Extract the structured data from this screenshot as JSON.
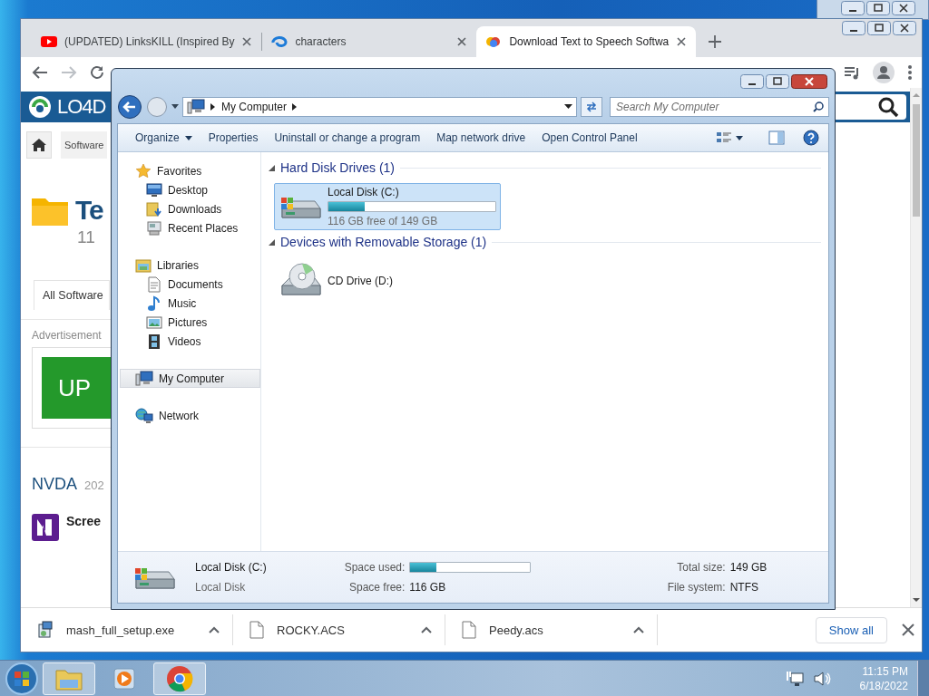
{
  "browser": {
    "tabs": [
      {
        "title": "(UPDATED) LinksKILL (Inspired By",
        "selected": false
      },
      {
        "title": "characters",
        "selected": false
      },
      {
        "title": "Download Text to Speech Softwa",
        "selected": true
      }
    ],
    "page": {
      "logo": "LO4D",
      "nav_tab": "Software",
      "title": "Te",
      "count": "11",
      "filter_tab": "All Software",
      "ad_label": "Advertisement",
      "ad_button": "UP",
      "app_name": "NVDA",
      "app_year": "202",
      "app_desc": "Scree"
    },
    "downloads": [
      {
        "name": "mash_full_setup.exe",
        "kind": "installer"
      },
      {
        "name": "ROCKY.ACS",
        "kind": "file"
      },
      {
        "name": "Peedy.acs",
        "kind": "file"
      }
    ],
    "show_all": "Show all"
  },
  "explorer": {
    "address": "My Computer",
    "search": {
      "placeholder": "Search My Computer"
    },
    "commands": [
      {
        "label": "Organize",
        "menu": true
      },
      {
        "label": "Properties",
        "menu": false
      },
      {
        "label": "Uninstall or change a program",
        "menu": false
      },
      {
        "label": "Map network drive",
        "menu": false
      },
      {
        "label": "Open Control Panel",
        "menu": false
      }
    ],
    "nav": [
      {
        "label": "Favorites",
        "kind": "star",
        "selected": false,
        "children": [
          {
            "label": "Desktop",
            "kind": "desktop",
            "selected": false
          },
          {
            "label": "Downloads",
            "kind": "downloads",
            "selected": false
          },
          {
            "label": "Recent Places",
            "kind": "recent",
            "selected": false
          }
        ]
      },
      {
        "label": "Libraries",
        "kind": "library",
        "selected": false,
        "children": [
          {
            "label": "Documents",
            "kind": "documents",
            "selected": false
          },
          {
            "label": "Music",
            "kind": "music",
            "selected": false
          },
          {
            "label": "Pictures",
            "kind": "pictures",
            "selected": false
          },
          {
            "label": "Videos",
            "kind": "videos",
            "selected": false
          }
        ]
      },
      {
        "label": "My Computer",
        "kind": "computer",
        "selected": true
      },
      {
        "label": "Network",
        "kind": "network",
        "selected": false
      }
    ],
    "groups": [
      {
        "title": "Hard Disk Drives (1)",
        "items": [
          {
            "kind": "disk",
            "name": "Local Disk (C:)",
            "free": "116 GB free of 149 GB",
            "level": 0.22,
            "selected": true
          }
        ]
      },
      {
        "title": "Devices with Removable Storage (1)",
        "items": [
          {
            "kind": "cd",
            "name": "CD Drive (D:)",
            "selected": false
          }
        ]
      }
    ],
    "details": {
      "name": "Local Disk (C:)",
      "type": "Local Disk",
      "fields": [
        {
          "label": "Space used:",
          "kind": "bar",
          "level": 0.22
        },
        {
          "label": "Total size:",
          "kind": "text",
          "value": "149 GB"
        },
        {
          "label": "Space free:",
          "kind": "text",
          "value": "116 GB"
        },
        {
          "label": "File system:",
          "kind": "text",
          "value": "NTFS"
        }
      ]
    }
  },
  "taskbar": {
    "time": "11:15 PM",
    "date": "6/18/2022"
  }
}
